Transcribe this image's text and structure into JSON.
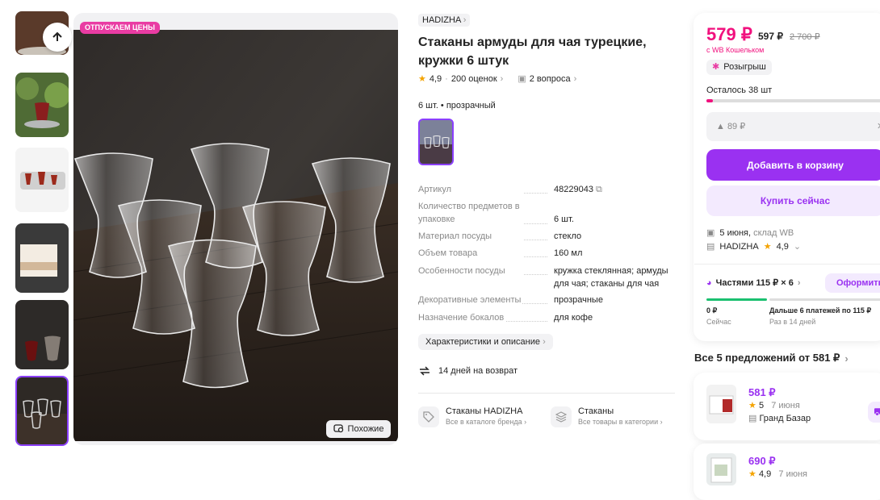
{
  "gallery": {
    "badge": "ОТПУСКАЕМ ЦЕНЫ",
    "similar_label": "Похожие",
    "thumbnails": [
      "thumb-1",
      "thumb-2",
      "thumb-3",
      "thumb-4",
      "thumb-5",
      "thumb-6"
    ]
  },
  "product": {
    "brand": "HADIZHA",
    "title": "Стаканы армуды для чая турецкие, кружки 6 штук",
    "rating": "4,9",
    "reviews": "200 оценок",
    "questions": "2 вопроса",
    "variant": "6 шт. • прозрачный",
    "specs": [
      {
        "k": "Артикул",
        "v": "48229043"
      },
      {
        "k": "Количество предметов в упаковке",
        "v": "6 шт."
      },
      {
        "k": "Материал посуды",
        "v": "стекло"
      },
      {
        "k": "Объем товара",
        "v": "160 мл"
      },
      {
        "k": "Особенности посуды",
        "v": "кружка стеклянная; армуды для чая; стаканы для чая"
      },
      {
        "k": "Декоративные элементы",
        "v": "прозрачные"
      },
      {
        "k": "Назначение бокалов",
        "v": "для кофе"
      }
    ],
    "char_button": "Характеристики и описание",
    "returns": "14 дней на возврат",
    "links": [
      {
        "t1": "Стаканы HADIZHA",
        "t2": "Все в каталоге бренда"
      },
      {
        "t1": "Стаканы",
        "t2": "Все товары в категории"
      }
    ]
  },
  "buy": {
    "price": "579 ₽",
    "price_regular": "597 ₽",
    "price_old": "2 700 ₽",
    "wallet": "с WB Кошельком",
    "lottery": "Розыгрыш",
    "left": "Осталось 38 шт",
    "stock_fraction": 0.035,
    "price_field": "▲ 89 ₽",
    "add_to_cart": "Добавить в корзину",
    "buy_now": "Купить сейчас",
    "delivery_date": "5 июня,",
    "delivery_wh": "склад WB",
    "seller": "HADIZHA",
    "seller_rating": "4,9",
    "installment": "Частями 115 ₽ × 6",
    "installment_btn": "Оформить",
    "inst_now_amount": "0 ₽",
    "inst_now_label": "Сейчас",
    "inst_next_amount": "Дальше 6 платежей по 115 ₽",
    "inst_next_label": "Раз в 14 дней"
  },
  "offers": {
    "title": "Все 5 предложений от 581 ₽",
    "items": [
      {
        "price": "581 ₽",
        "rating": "5",
        "date": "7 июня",
        "seller": "Гранд Базар"
      },
      {
        "price": "690 ₽",
        "rating": "4,9",
        "date": "7 июня"
      }
    ]
  },
  "colors": {
    "accent": "#9a31f1",
    "price": "#f1117e",
    "badge": "#e93ca3"
  }
}
